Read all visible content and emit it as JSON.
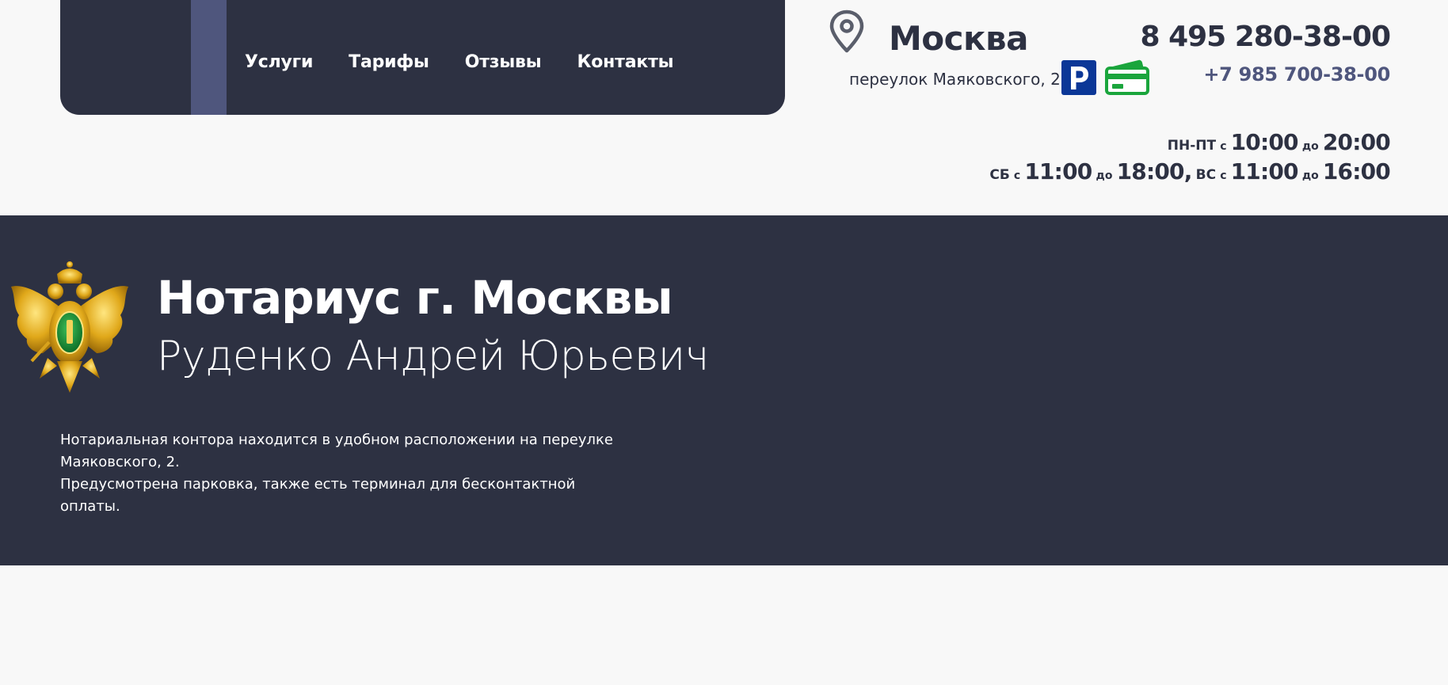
{
  "nav": {
    "items": [
      {
        "label": "Услуги"
      },
      {
        "label": "Тарифы"
      },
      {
        "label": "Отзывы"
      },
      {
        "label": "Контакты"
      }
    ]
  },
  "location": {
    "city": "Москва",
    "address": "переулок Маяковского, 2",
    "parking_icon": "parking-icon",
    "parking_letter": "P",
    "payment_icon": "credit-card-icon",
    "colors": {
      "parking": "#0b3797",
      "payment": "#1aa53c"
    }
  },
  "contacts": {
    "phone_main": "8 495 280-38-00",
    "phone_alt": "+7 985 700-38-00"
  },
  "hours": {
    "weekdays_label": "ПН-ПТ",
    "weekdays_from": "10:00",
    "weekdays_to": "20:00",
    "sat_label": "СБ",
    "sat_from": "11:00",
    "sat_to": "18:00",
    "sun_label": "ВС",
    "sun_from": "11:00",
    "sun_to": "16:00",
    "from_word": "с",
    "to_word": "до"
  },
  "hero": {
    "title": "Нотариус г. Москвы",
    "subtitle": "Руденко Андрей Юрьевич",
    "paragraph_1": "Нотариальная контора находится в удобном расположении на переулке Маяковского, 2.",
    "paragraph_2": "Предусмотрена парковка, также есть терминал для бесконтактной оплаты.",
    "emblem_icon": "notary-emblem-icon"
  },
  "colors": {
    "dark": "#2d3142",
    "accent": "#4f567d",
    "background": "#f8f8f8"
  }
}
